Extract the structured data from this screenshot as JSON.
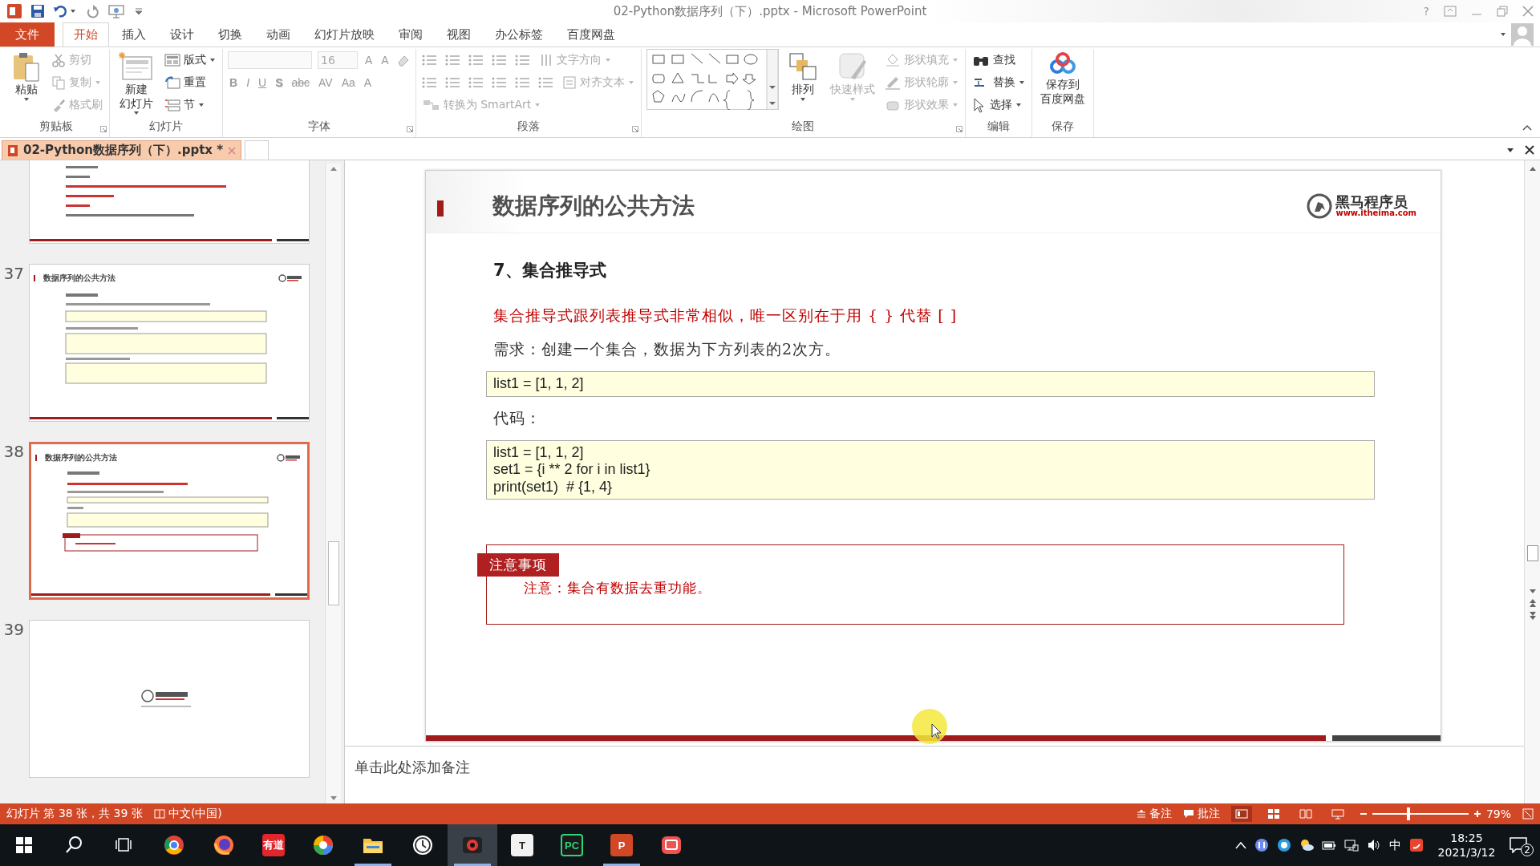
{
  "window": {
    "title": "02-Python数据序列（下）.pptx - Microsoft PowerPoint",
    "help": "?"
  },
  "menu_tabs": [
    {
      "label": "文件",
      "kind": "file",
      "selected": false
    },
    {
      "label": "开始",
      "kind": "tab",
      "selected": true
    },
    {
      "label": "插入",
      "kind": "tab",
      "selected": false
    },
    {
      "label": "设计",
      "kind": "tab",
      "selected": false
    },
    {
      "label": "切换",
      "kind": "tab",
      "selected": false
    },
    {
      "label": "动画",
      "kind": "tab",
      "selected": false
    },
    {
      "label": "幻灯片放映",
      "kind": "tab",
      "selected": false
    },
    {
      "label": "审阅",
      "kind": "tab",
      "selected": false
    },
    {
      "label": "视图",
      "kind": "tab",
      "selected": false
    },
    {
      "label": "办公标签",
      "kind": "tab",
      "selected": false
    },
    {
      "label": "百度网盘",
      "kind": "tab",
      "selected": false
    }
  ],
  "ribbon": {
    "groups": [
      {
        "label": "剪贴板",
        "launcher": true,
        "columns": [
          {
            "kind": "large",
            "lines": [
              "粘贴"
            ],
            "dropdown": true,
            "disabled": false
          },
          {
            "kind": "stack",
            "items": [
              {
                "kind": "button",
                "label": "剪切",
                "disabled": true,
                "dropdown": false
              },
              {
                "kind": "button",
                "label": "复制",
                "disabled": true,
                "dropdown": true
              },
              {
                "kind": "button",
                "label": "格式刷",
                "disabled": true,
                "dropdown": false
              }
            ]
          }
        ]
      },
      {
        "label": "幻灯片",
        "launcher": false,
        "columns": [
          {
            "kind": "large",
            "lines": [
              "新建",
              "幻灯片"
            ],
            "dropdown": true,
            "disabled": false
          },
          {
            "kind": "stack",
            "items": [
              {
                "kind": "button",
                "label": "版式",
                "disabled": false,
                "dropdown": true
              },
              {
                "kind": "button",
                "label": "重置",
                "disabled": false,
                "dropdown": false
              },
              {
                "kind": "button",
                "label": "节",
                "disabled": false,
                "dropdown": true
              }
            ]
          }
        ]
      },
      {
        "label": "字体",
        "launcher": true,
        "columns": [
          {
            "kind": "stack",
            "items": [
              {
                "kind": "row",
                "items": [
                  {
                    "kind": "field",
                    "disabled": true
                  },
                  {
                    "kind": "field",
                    "value": "16",
                    "disabled": true
                  },
                  {
                    "kind": "glyph",
                    "label": "A",
                    "disabled": true
                  },
                  {
                    "kind": "glyph",
                    "label": "A",
                    "disabled": true
                  },
                  {
                    "kind": "icon",
                    "disabled": true
                  }
                ]
              },
              {
                "kind": "row",
                "items": [
                  {
                    "kind": "glyph",
                    "label": "B",
                    "disabled": true
                  },
                  {
                    "kind": "glyph",
                    "label": "I",
                    "disabled": true
                  },
                  {
                    "kind": "glyph",
                    "label": "U",
                    "disabled": true
                  },
                  {
                    "kind": "glyph",
                    "label": "S",
                    "disabled": true
                  },
                  {
                    "kind": "glyph",
                    "label": "abc",
                    "disabled": true
                  },
                  {
                    "kind": "glyph",
                    "label": "AV",
                    "disabled": true
                  },
                  {
                    "kind": "glyph",
                    "label": "Aa",
                    "disabled": true
                  },
                  {
                    "kind": "glyph",
                    "label": "A",
                    "disabled": true
                  }
                ]
              }
            ]
          }
        ]
      },
      {
        "label": "段落",
        "launcher": true,
        "columns": [
          {
            "kind": "stack",
            "items": [
              {
                "kind": "row",
                "items": [
                  {
                    "kind": "icon",
                    "disabled": true
                  },
                  {
                    "kind": "icon",
                    "disabled": true
                  },
                  {
                    "kind": "icon",
                    "disabled": true
                  },
                  {
                    "kind": "icon",
                    "disabled": true
                  },
                  {
                    "kind": "icon",
                    "disabled": true
                  },
                  {
                    "kind": "button",
                    "label": "文字方向",
                    "disabled": true,
                    "dropdown": true
                  }
                ]
              },
              {
                "kind": "row",
                "items": [
                  {
                    "kind": "icon",
                    "disabled": true
                  },
                  {
                    "kind": "icon",
                    "disabled": true
                  },
                  {
                    "kind": "icon",
                    "disabled": true
                  },
                  {
                    "kind": "icon",
                    "disabled": true
                  },
                  {
                    "kind": "icon",
                    "disabled": true
                  },
                  {
                    "kind": "icon",
                    "disabled": true
                  },
                  {
                    "kind": "button",
                    "label": "对齐文本",
                    "disabled": true,
                    "dropdown": true
                  }
                ]
              },
              {
                "kind": "button",
                "label": "转换为 SmartArt",
                "disabled": true,
                "dropdown": true
              }
            ]
          }
        ]
      },
      {
        "label": "绘图",
        "launcher": true,
        "columns": [
          {
            "kind": "gallery"
          },
          {
            "kind": "large",
            "lines": [
              "排列"
            ],
            "dropdown": true,
            "disabled": false
          },
          {
            "kind": "large",
            "lines": [
              "快速样式"
            ],
            "dropdown": true,
            "disabled": true
          },
          {
            "kind": "stack",
            "items": [
              {
                "kind": "button",
                "label": "形状填充",
                "disabled": true,
                "dropdown": true
              },
              {
                "kind": "button",
                "label": "形状轮廓",
                "disabled": true,
                "dropdown": true
              },
              {
                "kind": "button",
                "label": "形状效果",
                "disabled": true,
                "dropdown": true
              }
            ]
          }
        ]
      },
      {
        "label": "编辑",
        "launcher": false,
        "columns": [
          {
            "kind": "stack",
            "items": [
              {
                "kind": "button",
                "label": "查找",
                "disabled": false,
                "dropdown": false
              },
              {
                "kind": "button",
                "label": "替换",
                "disabled": false,
                "dropdown": true
              },
              {
                "kind": "button",
                "label": "选择",
                "disabled": false,
                "dropdown": true
              }
            ]
          }
        ]
      },
      {
        "label": "保存",
        "launcher": false,
        "columns": [
          {
            "kind": "large",
            "lines": [
              "保存到",
              "百度网盘"
            ],
            "dropdown": false,
            "disabled": false
          }
        ]
      }
    ]
  },
  "document_tabs": [
    {
      "label": "02-Python数据序列（下）.pptx *",
      "selected": true
    }
  ],
  "slides_panel": {
    "thumbnails": [
      {
        "kind": "text",
        "selected": false
      },
      {
        "number": "37",
        "kind": "content",
        "title": "数据序列的公共方法",
        "selected": false
      },
      {
        "number": "38",
        "kind": "content",
        "title": "数据序列的公共方法",
        "selected": true
      },
      {
        "number": "39",
        "kind": "end",
        "selected": false
      }
    ]
  },
  "slide": {
    "title": "数据序列的公共方法",
    "logo": {
      "name": "黑马程序员",
      "url": "www.itheima.com"
    },
    "blocks": [
      {
        "kind": "heading",
        "text": "7、集合推导式"
      },
      {
        "kind": "highlight",
        "text": "集合推导式跟列表推导式非常相似，唯一区别在于用 { } 代替 [ ]"
      },
      {
        "kind": "paragraph",
        "text": "需求：创建一个集合，数据为下方列表的2次方。"
      },
      {
        "kind": "code",
        "lines": [
          "list1 = [1, 1, 2]"
        ]
      },
      {
        "kind": "paragraph",
        "text": "代码："
      },
      {
        "kind": "code",
        "lines": [
          "list1 = [1, 1, 2]",
          "set1 = {i ** 2 for i in list1}",
          "print(set1)  # {1, 4}"
        ]
      },
      {
        "kind": "note",
        "label": "注意事项",
        "text": "注意：集合有数据去重功能。"
      }
    ]
  },
  "pointer_highlight": true,
  "notes": {
    "placeholder": "单击此处添加备注"
  },
  "status_bar": {
    "slide_info": "幻灯片 第 38 张，共 39 张",
    "language": "中文(中国)",
    "notes": "备注",
    "comments": "批注",
    "views": [
      {
        "selected": true
      },
      {
        "selected": false
      },
      {
        "selected": false
      },
      {
        "selected": false
      }
    ],
    "zoom": {
      "level": 0.38
    },
    "zoom_text": "79%"
  },
  "taskbar": {
    "apps": [
      {
        "kind": "start",
        "running": false,
        "active": false
      },
      {
        "kind": "search",
        "running": false,
        "active": false
      },
      {
        "kind": "task_view",
        "running": false,
        "active": false
      },
      {
        "kind": "round_browser",
        "running": false,
        "active": false
      },
      {
        "kind": "fox_browser",
        "running": false,
        "active": false
      },
      {
        "kind": "label_app",
        "label": "有道",
        "color": "#e3252c",
        "running": false,
        "active": false
      },
      {
        "kind": "color_wheel",
        "running": false,
        "active": false
      },
      {
        "kind": "folder",
        "running": true,
        "active": false
      },
      {
        "kind": "clock",
        "running": false,
        "active": false
      },
      {
        "kind": "recorder",
        "running": true,
        "active": true
      },
      {
        "kind": "label_app",
        "label": "T",
        "color": "#f2f2f2",
        "running": false,
        "active": false
      },
      {
        "kind": "label_app",
        "label": "PC",
        "color": "#1a1a1a",
        "running": false,
        "active": false
      },
      {
        "kind": "label_app",
        "label": "P",
        "color": "#d24726",
        "running": true,
        "active": false
      },
      {
        "kind": "video",
        "running": false,
        "active": false
      }
    ],
    "tray": {
      "ime": "中",
      "time": "18:25",
      "date": "2021/3/12",
      "notifications": "2"
    }
  }
}
